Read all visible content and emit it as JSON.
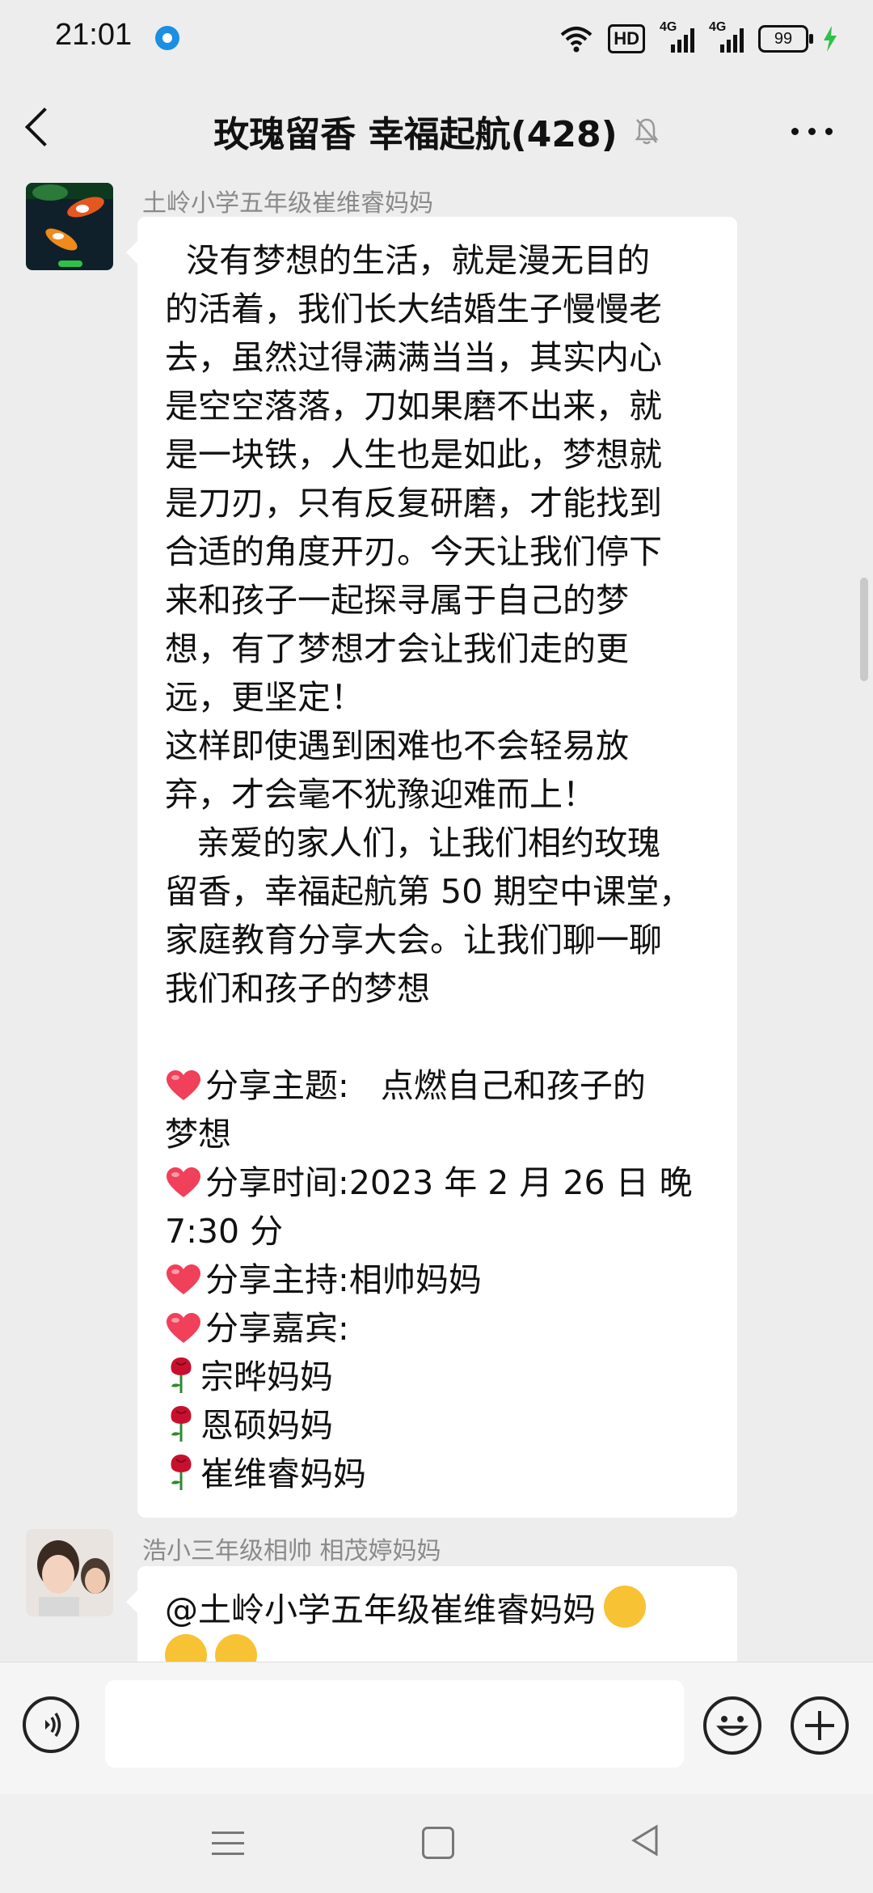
{
  "status": {
    "time": "21:01",
    "hd_label": "HD",
    "signal1_label": "4G",
    "signal2_label": "4G",
    "battery": "99"
  },
  "header": {
    "title": "玫瑰留香  幸福起航(428)"
  },
  "messages": [
    {
      "sender": "土岭小学五年级崔维睿妈妈",
      "lines": [
        "  没有梦想的生活，就是漫无目的",
        "的活着，我们长大结婚生子慢慢老",
        "去，虽然过得满满当当，其实内心",
        "是空空落落，刀如果磨不出来，就",
        "是一块铁，人生也是如此，梦想就",
        "是刀刃，只有反复研磨，才能找到",
        "合适的角度开刃。今天让我们停下",
        "来和孩子一起探寻属于自己的梦",
        "想，有了梦想才会让我们走的更",
        "远，更坚定！",
        "这样即使遇到困难也不会轻易放",
        "弃，才会毫不犹豫迎难而上！",
        "   亲爱的家人们，让我们相约玫瑰",
        "留香，幸福起航第 50 期空中课堂，",
        "家庭教育分享大会。让我们聊一聊",
        "我们和孩子的梦想"
      ],
      "share_items": [
        {
          "icon": "heart-icon",
          "text": "分享主题:   点燃自己和孩子的"
        },
        {
          "icon": "",
          "text": "梦想"
        },
        {
          "icon": "heart-icon",
          "text": "分享时间:2023 年 2 月 26 日 晚"
        },
        {
          "icon": "",
          "text": "7:30 分"
        },
        {
          "icon": "heart-icon",
          "text": "分享主持:相帅妈妈"
        },
        {
          "icon": "heart-icon",
          "text": "分享嘉宾:"
        },
        {
          "icon": "rose-icon",
          "text": "宗晔妈妈"
        },
        {
          "icon": "rose-icon",
          "text": "恩硕妈妈"
        },
        {
          "icon": "rose-icon",
          "text": "崔维睿妈妈"
        }
      ]
    },
    {
      "sender": "浩小三年级相帅  相茂婷妈妈",
      "text": "@土岭小学五年级崔维睿妈妈"
    }
  ],
  "colors": {
    "background": "#ededed",
    "bubble": "#ffffff",
    "sender_text": "#8a8a8a",
    "heart": "#f0405a",
    "rose": "#c8102e"
  }
}
